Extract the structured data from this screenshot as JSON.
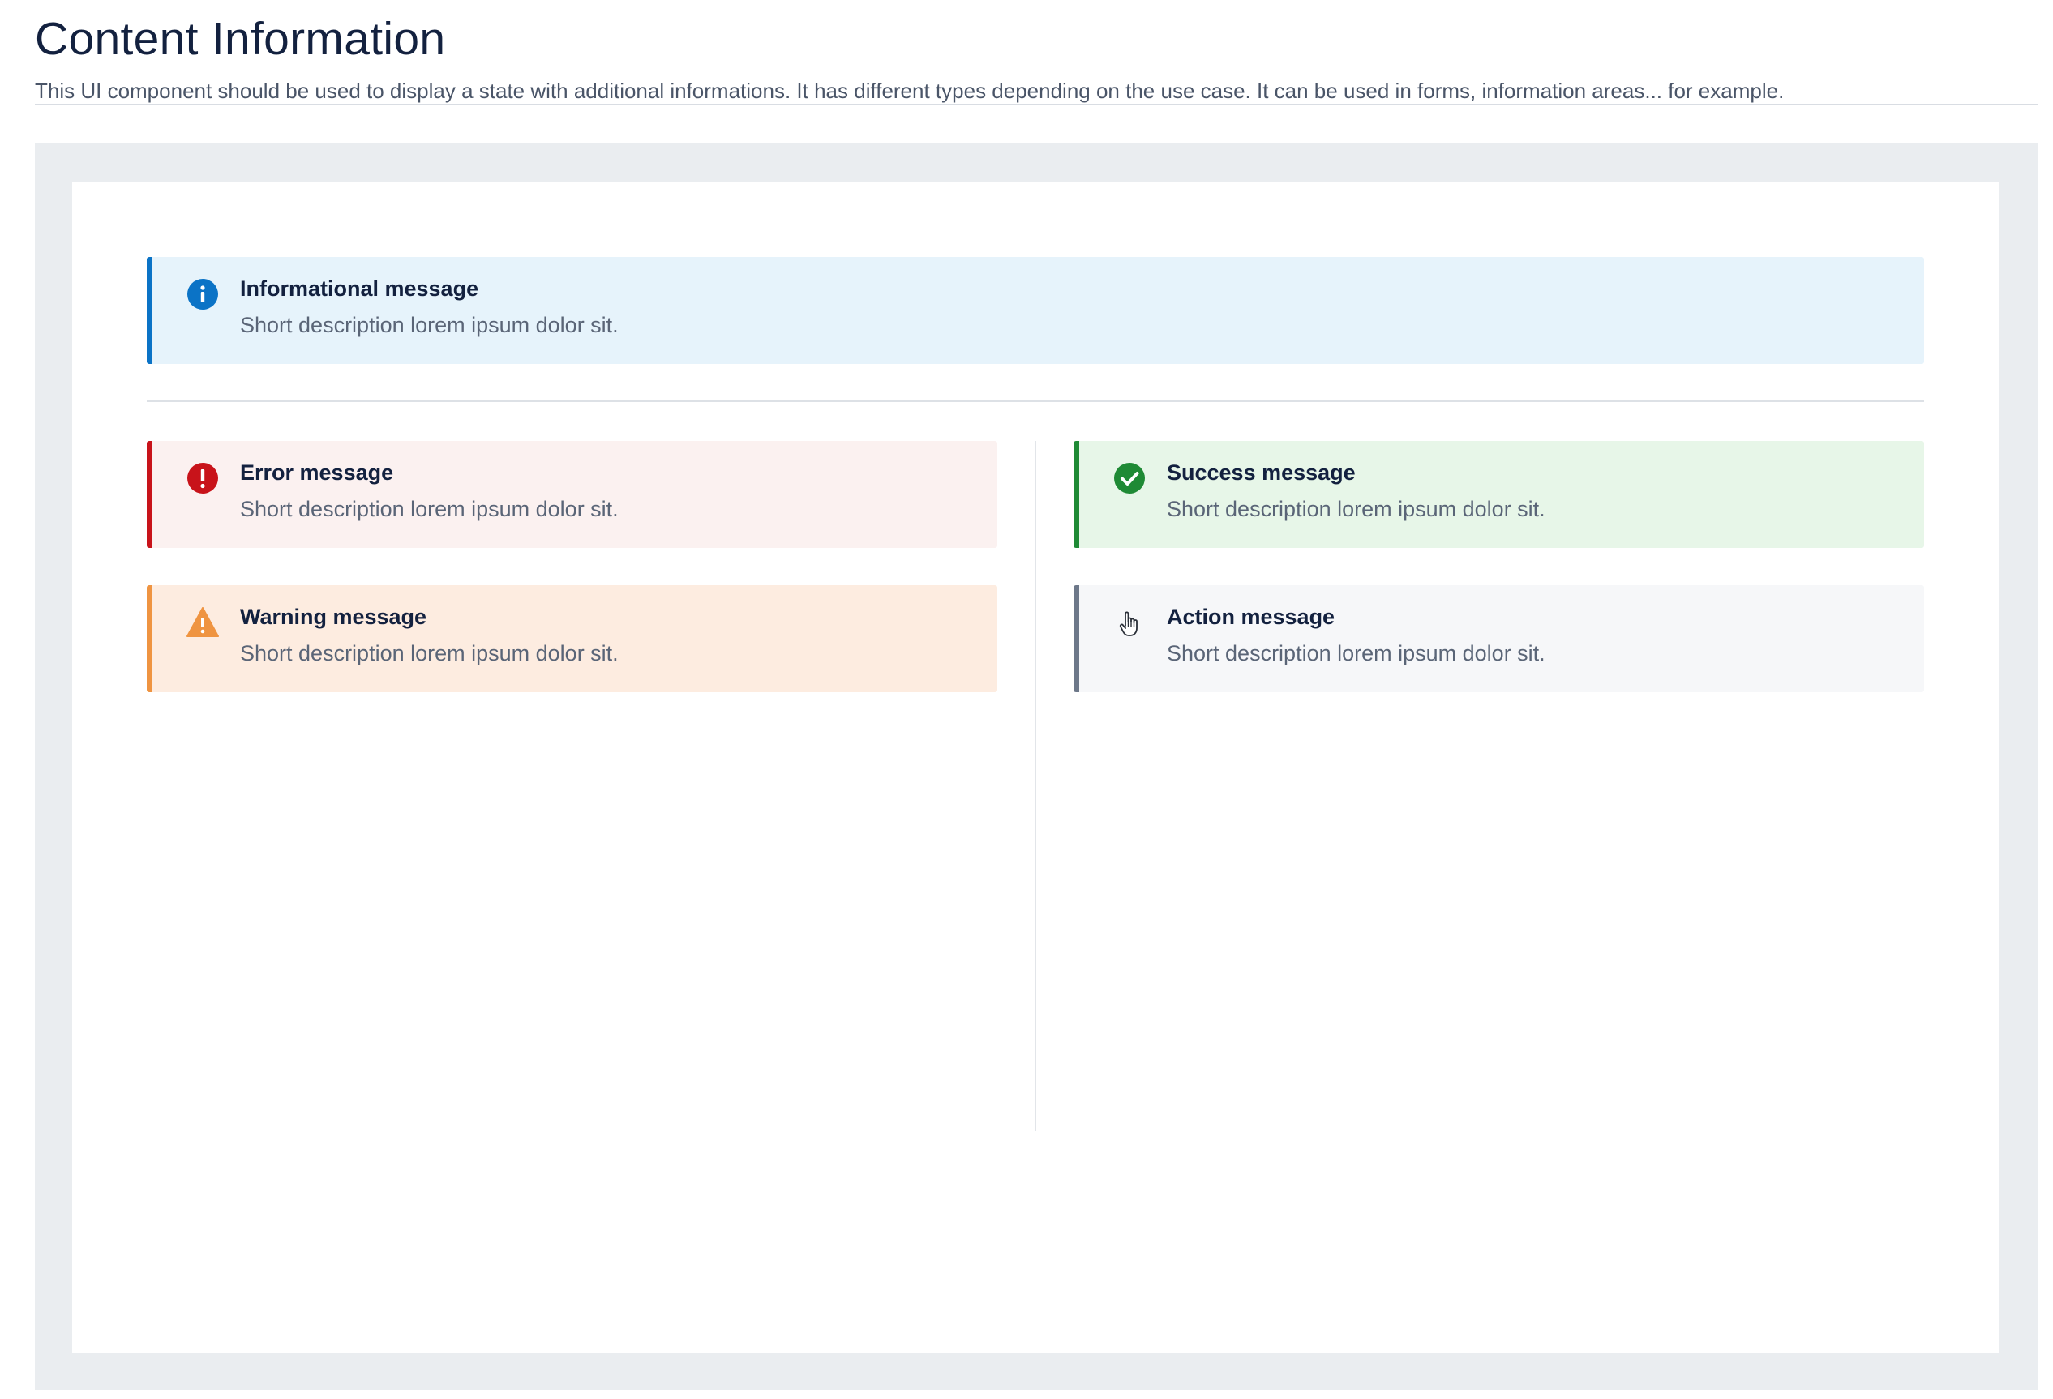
{
  "header": {
    "title": "Content Information",
    "subtitle": "This UI component should be used to display a state with additional informations. It has different types depending on the use case. It can be used in forms, information areas... for example."
  },
  "colors": {
    "info": "#0b73c6",
    "error": "#c8131a",
    "warning": "#ef9441",
    "success": "#1f8a35",
    "action": "#6d7889"
  },
  "messages": {
    "info": {
      "icon": "info-icon",
      "title": "Informational message",
      "description": "Short description lorem ipsum dolor sit."
    },
    "error": {
      "icon": "error-icon",
      "title": "Error message",
      "description": "Short description lorem ipsum dolor sit."
    },
    "warning": {
      "icon": "warning-icon",
      "title": "Warning message",
      "description": "Short description lorem ipsum dolor sit."
    },
    "success": {
      "icon": "check-circle-icon",
      "title": "Success message",
      "description": "Short description lorem ipsum dolor sit."
    },
    "action": {
      "icon": "hand-pointer-icon",
      "title": "Action message",
      "description": "Short description lorem ipsum dolor sit."
    }
  }
}
